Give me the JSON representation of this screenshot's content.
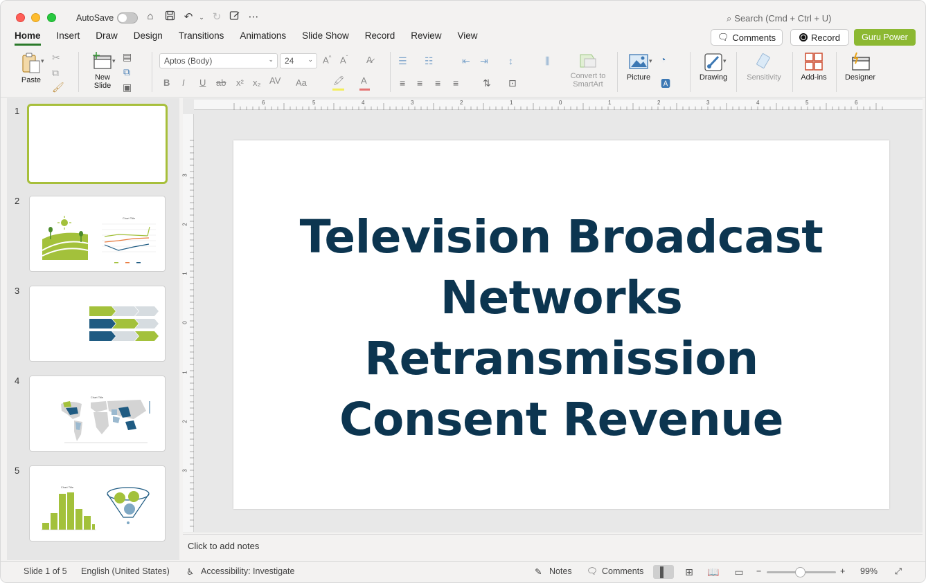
{
  "titlebar": {
    "autosave_label": "AutoSave",
    "search_placeholder": "Search (Cmd + Ctrl + U)"
  },
  "tabs": [
    "Home",
    "Insert",
    "Draw",
    "Design",
    "Transitions",
    "Animations",
    "Slide Show",
    "Record",
    "Review",
    "View"
  ],
  "header_buttons": {
    "comments": "Comments",
    "record": "Record",
    "guru": "Guru Power"
  },
  "ribbon": {
    "paste": "Paste",
    "new_slide_line1": "New",
    "new_slide_line2": "Slide",
    "font_name": "Aptos (Body)",
    "font_size": "24",
    "convert_line1": "Convert to",
    "convert_line2": "SmartArt",
    "picture": "Picture",
    "drawing": "Drawing",
    "sensitivity": "Sensitivity",
    "addins": "Add-ins",
    "designer": "Designer"
  },
  "thumbnails": [
    {
      "number": "1",
      "chart_title": ""
    },
    {
      "number": "2",
      "chart_title": "Chart Title"
    },
    {
      "number": "3",
      "chart_title": ""
    },
    {
      "number": "4",
      "chart_title": "Chart Title"
    },
    {
      "number": "5",
      "chart_title": "Chart Title"
    }
  ],
  "slide": {
    "title_lines": [
      "Television Broadcast",
      "Networks",
      "Retransmission",
      "Consent Revenue"
    ]
  },
  "ruler": {
    "h_labels": [
      "6",
      "5",
      "4",
      "3",
      "2",
      "1",
      "0",
      "1",
      "2",
      "3",
      "4",
      "5",
      "6"
    ],
    "v_labels": [
      "3",
      "2",
      "1",
      "0",
      "1",
      "2",
      "3"
    ]
  },
  "notes_placeholder": "Click to add notes",
  "status": {
    "slide_counter": "Slide 1 of 5",
    "language": "English (United States)",
    "accessibility": "Accessibility: Investigate",
    "notes": "Notes",
    "comments": "Comments",
    "zoom": "99%"
  },
  "colors": {
    "accent_green": "#8cb832",
    "title_navy": "#0c3550",
    "thumb_green": "#a3c13b",
    "thumb_blue": "#1f5b82"
  }
}
